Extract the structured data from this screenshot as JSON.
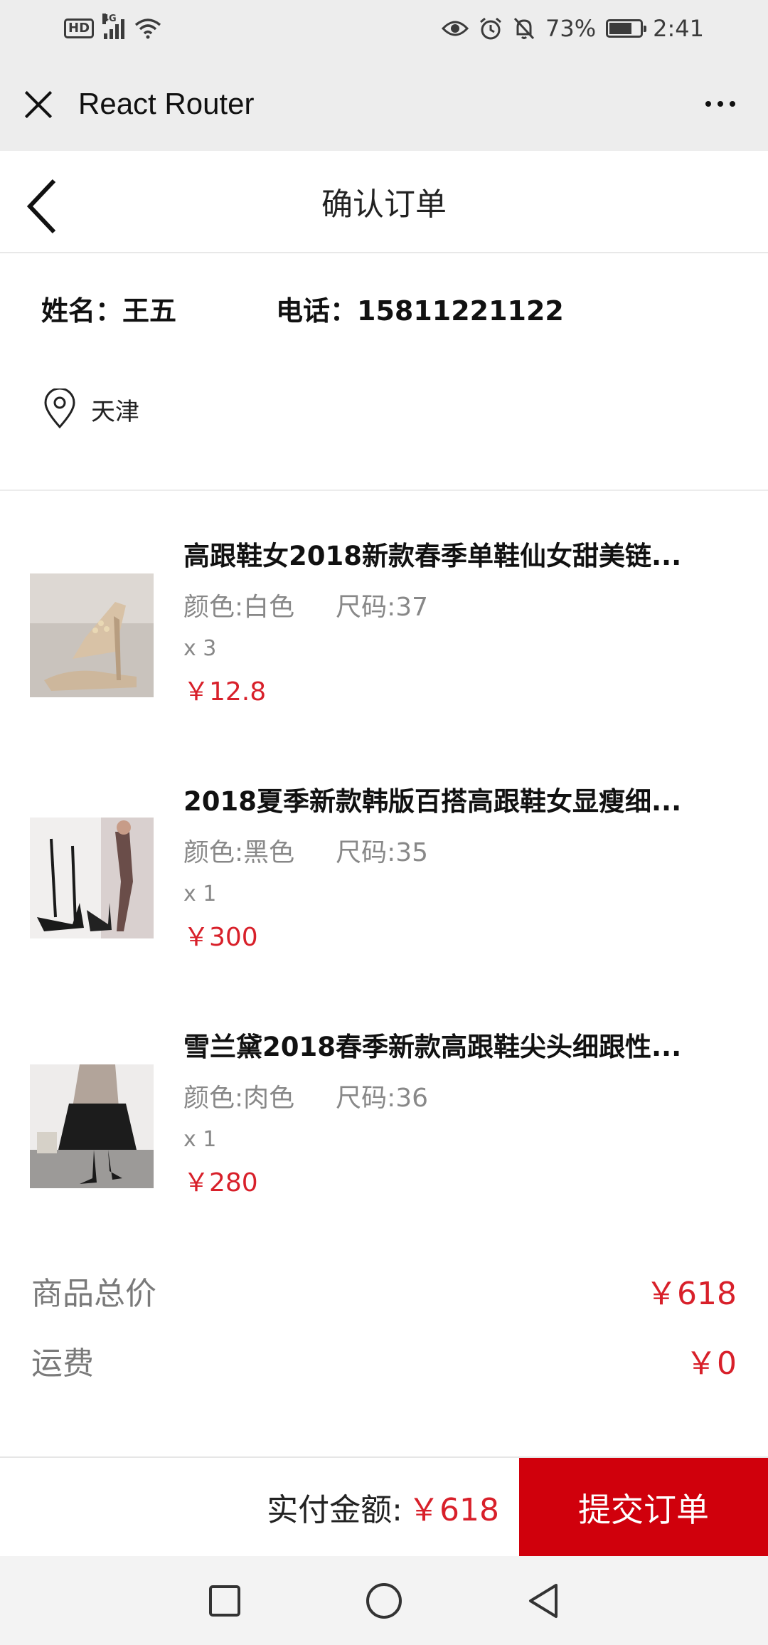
{
  "status_bar": {
    "hd_badge": "HD",
    "network": "4G",
    "battery": "73%",
    "battery_level": 0.73,
    "time": "2:41",
    "icons": [
      "hd-icon",
      "signal-icon",
      "wifi-icon",
      "eye-icon",
      "alarm-icon",
      "bell-off-icon",
      "battery-icon"
    ]
  },
  "title_bar": {
    "title": "React Router"
  },
  "header": {
    "title": "确认订单"
  },
  "address": {
    "name": "姓名：王五",
    "phone": "电话：15811221122",
    "location": "天津"
  },
  "products": [
    {
      "name": "高跟鞋女2018新款春季单鞋仙女甜美链...",
      "color": "颜色:白色",
      "size": "尺码:37",
      "qty": "x 3",
      "price": "￥12.8"
    },
    {
      "name": "2018夏季新款韩版百搭高跟鞋女显瘦细...",
      "color": "颜色:黑色",
      "size": "尺码:35",
      "qty": "x 1",
      "price": "￥300"
    },
    {
      "name": "雪兰黛2018春季新款高跟鞋尖头细跟性...",
      "color": "颜色:肉色",
      "size": "尺码:36",
      "qty": "x 1",
      "price": "￥280"
    }
  ],
  "totals": {
    "subtotal_label": "商品总价",
    "subtotal_value": "￥618",
    "shipping_label": "运费",
    "shipping_value": "￥0"
  },
  "bottom_bar": {
    "pay_label": "实付金额:",
    "pay_value": "￥618",
    "submit_label": "提交订单"
  },
  "colors": {
    "accent_red": "#d0000c",
    "price_red": "#d8202a",
    "bar_gray": "#ededed"
  }
}
